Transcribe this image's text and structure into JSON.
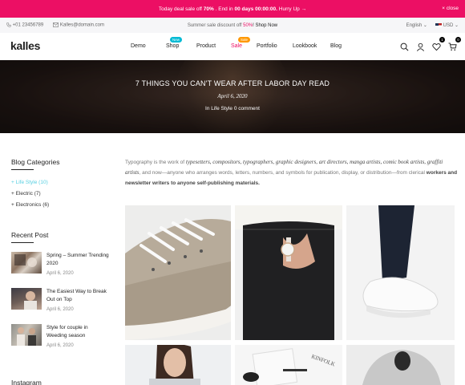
{
  "promo": {
    "prefix": "Today deal sale off",
    "percent": "70%",
    "mid": ". End in",
    "countdown": "00 days 00:00:00.",
    "suffix": "Hurry Up",
    "arrow": "→",
    "close": "× close"
  },
  "topbar": {
    "phone": "+01 23456789",
    "email": "Kalles@domain.com",
    "sale_prefix": "Summer sale discount off",
    "sale_percent": "50%",
    "sale_suffix": "! Shop Now",
    "language": "English",
    "currency": "USD"
  },
  "header": {
    "logo": "kalles",
    "nav": [
      {
        "label": "Demo"
      },
      {
        "label": "Shop",
        "badge": "New"
      },
      {
        "label": "Product"
      },
      {
        "label": "Sale",
        "badge": "Sale"
      },
      {
        "label": "Portfolio"
      },
      {
        "label": "Lookbook"
      },
      {
        "label": "Blog"
      }
    ],
    "wishlist_count": "1",
    "cart_count": "0"
  },
  "hero": {
    "title": "7 THINGS YOU CAN'T WEAR AFTER LABOR DAY READ",
    "date": "April 6, 2020",
    "category_prefix": "In",
    "category": "Life Style",
    "comments": "0 comment"
  },
  "sidebar": {
    "categories_title": "Blog Categories",
    "categories": [
      {
        "label": "Life Style",
        "count": "(10)",
        "active": true
      },
      {
        "label": "Electric",
        "count": "(7)",
        "active": false
      },
      {
        "label": "Electronics",
        "count": "(6)",
        "active": false
      }
    ],
    "recent_title": "Recent Post",
    "posts": [
      {
        "title": "Spring – Summer Trending 2020",
        "date": "April 6, 2020"
      },
      {
        "title": "The Easiest Way to Break Out on Top",
        "date": "April 6, 2020"
      },
      {
        "title": "Style for couple in Weeding season",
        "date": "April 6, 2020"
      }
    ],
    "instagram_title": "Instagram"
  },
  "article": {
    "p1": "Typography is the work of ",
    "i1": "typesetters, compositors, typographers, graphic designers, art directors, manga artists, comic book artists, graffiti artists",
    "p2": ", and now—anyone who arranges words, letters, numbers, and symbols for publication, display, or distribution—from clerical ",
    "b1": "workers and newsletter writers to anyone self-publishing materials."
  },
  "colors": {
    "accent": "#ec0f64",
    "active_link": "#56cfe1",
    "badge_new": "#01bad4",
    "badge_sale": "#ff9800"
  },
  "icons": [
    "search-icon",
    "user-icon",
    "heart-icon",
    "cart-icon",
    "phone-icon",
    "mail-icon",
    "chevron-down-icon"
  ]
}
